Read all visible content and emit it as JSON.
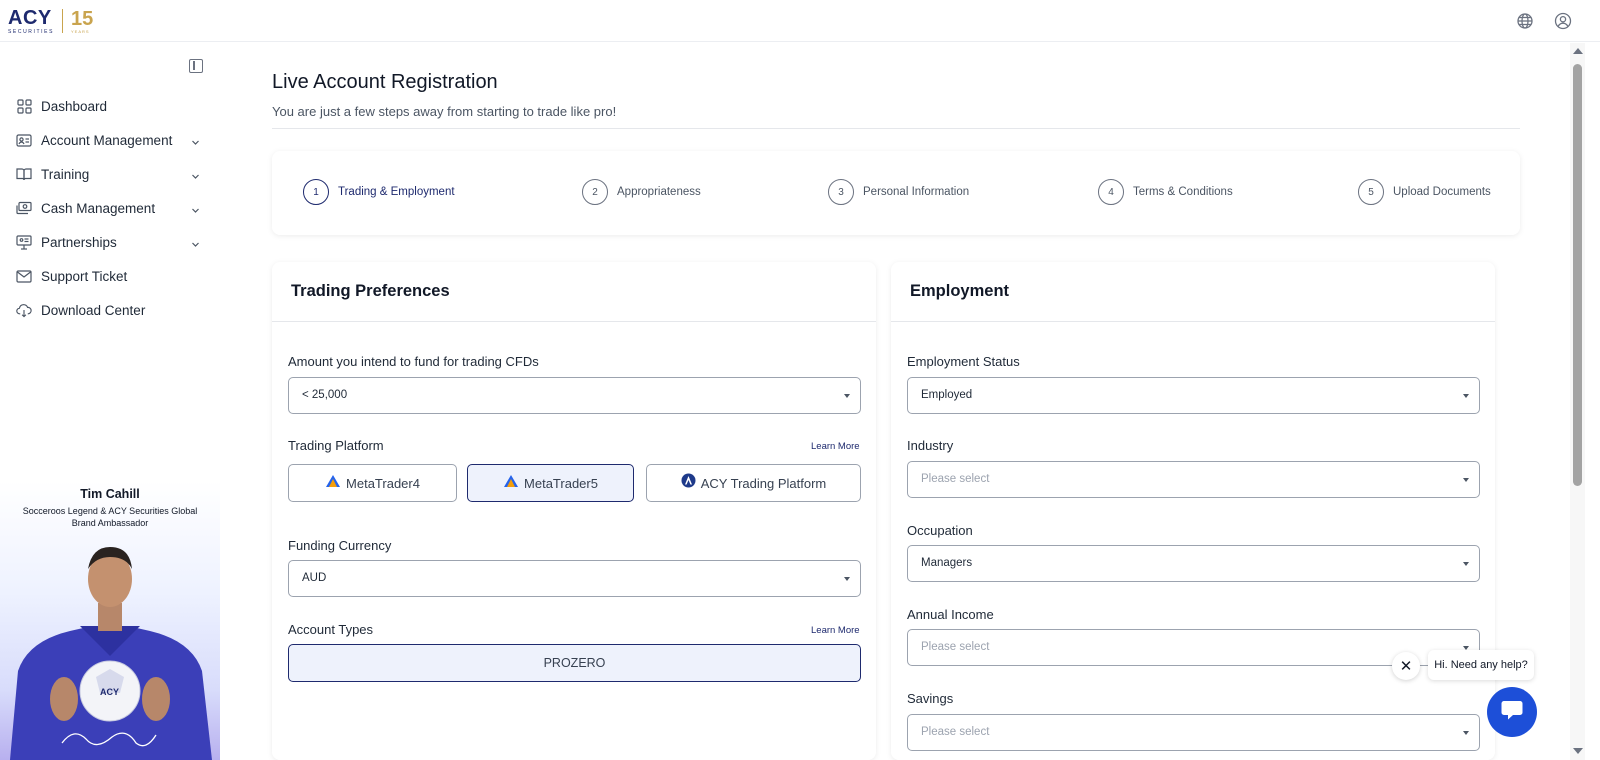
{
  "brand": {
    "logo_text": "ACY",
    "logo_sub": "SECURITIES",
    "anniversary": "15",
    "anniversary_sub": "YEARS"
  },
  "topbar": {
    "icons": [
      "globe-icon",
      "user-icon"
    ]
  },
  "sidebar": {
    "items": [
      {
        "label": "Dashboard",
        "icon": "dashboard-icon",
        "has_chevron": false
      },
      {
        "label": "Account Management",
        "icon": "id-card-icon",
        "has_chevron": true
      },
      {
        "label": "Training",
        "icon": "book-icon",
        "has_chevron": true
      },
      {
        "label": "Cash Management",
        "icon": "cash-icon",
        "has_chevron": true
      },
      {
        "label": "Partnerships",
        "icon": "presentation-icon",
        "has_chevron": true
      },
      {
        "label": "Support Ticket",
        "icon": "mail-icon",
        "has_chevron": false
      },
      {
        "label": "Download Center",
        "icon": "cloud-download-icon",
        "has_chevron": false
      }
    ],
    "ambassador": {
      "name": "Tim Cahill",
      "title": "Socceroos Legend & ACY Securities Global Brand Ambassador"
    }
  },
  "page": {
    "title": "Live Account Registration",
    "subtitle": "You are just a few steps away from starting to trade like pro!"
  },
  "steps": [
    {
      "num": "1",
      "label": "Trading & Employment",
      "active": true
    },
    {
      "num": "2",
      "label": "Appropriateness",
      "active": false
    },
    {
      "num": "3",
      "label": "Personal Information",
      "active": false
    },
    {
      "num": "4",
      "label": "Terms & Conditions",
      "active": false
    },
    {
      "num": "5",
      "label": "Upload Documents",
      "active": false
    }
  ],
  "trading": {
    "title": "Trading Preferences",
    "fund_label": "Amount you intend to fund for trading CFDs",
    "fund_value": "< 25,000",
    "platform_label": "Trading Platform",
    "learn_more": "Learn More",
    "platforms": [
      "MetaTrader4",
      "MetaTrader5",
      "ACY Trading Platform"
    ],
    "selected_platform": "MetaTrader5",
    "currency_label": "Funding Currency",
    "currency_value": "AUD",
    "account_types_label": "Account Types",
    "account_type": "PROZERO"
  },
  "employment": {
    "title": "Employment",
    "status_label": "Employment Status",
    "status_value": "Employed",
    "industry_label": "Industry",
    "industry_placeholder": "Please select",
    "occupation_label": "Occupation",
    "occupation_value": "Managers",
    "income_label": "Annual Income",
    "income_placeholder": "Please select",
    "savings_label": "Savings",
    "savings_placeholder": "Please select"
  },
  "help": {
    "bubble": "Hi. Need any help?",
    "close": "✕"
  },
  "colors": {
    "brand_navy": "#1e2a6e",
    "brand_gold": "#c9a44e",
    "help_blue": "#1d4fd8",
    "selected_bg": "#eef2fc"
  }
}
